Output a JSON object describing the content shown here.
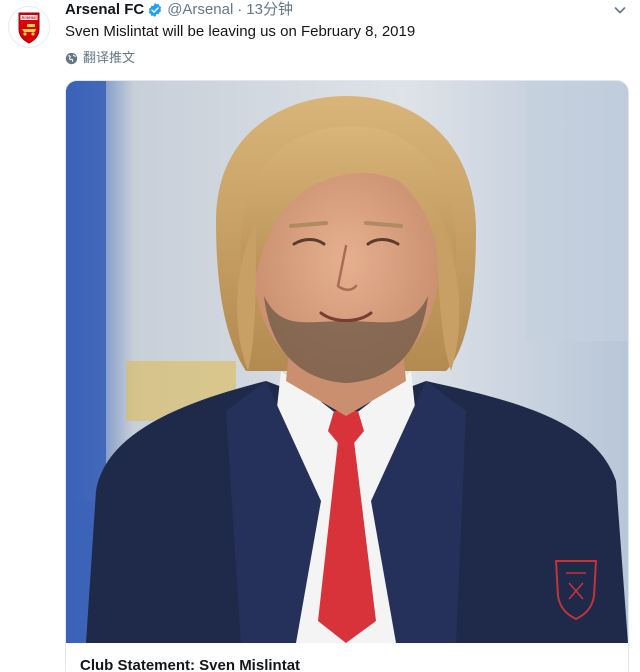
{
  "tweet": {
    "display_name": "Arsenal FC",
    "handle": "@Arsenal",
    "separator": "·",
    "time": "13分钟",
    "text": "Sven Mislintat will be leaving us on February 8, 2019",
    "translate_label": "翻译推文",
    "avatar_text": "Arsenal",
    "verified_icon": "verified-badge-icon",
    "caret_icon": "chevron-down-icon",
    "translate_icon": "globe-icon"
  },
  "card": {
    "title": "Club Statement: Sven Mislintat",
    "image_icon": "photo"
  },
  "colors": {
    "verified_blue": "#1da1f2",
    "arsenal_red": "#db0007",
    "text_primary": "#14171a",
    "text_secondary": "#657786",
    "suit_navy": "#1f2a4a",
    "tie_red": "#d8333a"
  }
}
